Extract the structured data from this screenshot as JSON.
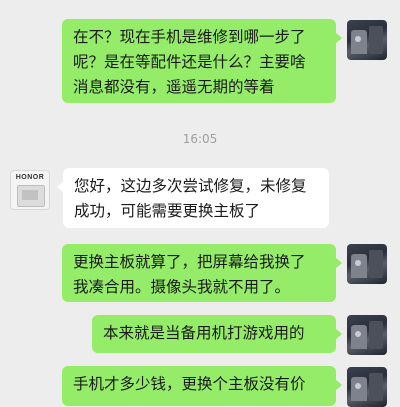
{
  "timestamp": "16:05",
  "messages": [
    {
      "from": "user",
      "lines": [
        "在不？现在手机是维修到哪一步了",
        "呢？是在等配件还是什么？主要啥",
        "消息都没有，遥遥无期的等着"
      ]
    },
    {
      "from": "service",
      "avatar_label": "HONOR",
      "lines": [
        "您好，这边多次尝试修复，未修复",
        "成功，可能需要更换主板了"
      ]
    },
    {
      "from": "user",
      "lines": [
        "更换主板就算了，把屏幕给我换了",
        "我凑合用。摄像头我就不用了。"
      ]
    },
    {
      "from": "user",
      "lines": [
        "本来就是当备用机打游戏用的"
      ]
    },
    {
      "from": "user",
      "lines": [
        "手机才多少钱，更换个主板没有价"
      ]
    }
  ],
  "colors": {
    "background": "#ededed",
    "outgoing_bubble": "#95ec69",
    "incoming_bubble": "#ffffff",
    "timestamp_text": "#9e9e9e"
  }
}
